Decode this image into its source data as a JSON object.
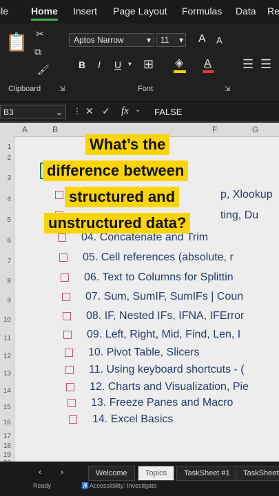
{
  "menu": {
    "tabs": [
      "ile",
      "Home",
      "Insert",
      "Page Layout",
      "Formulas",
      "Data",
      "Re"
    ],
    "active": "Home"
  },
  "ribbon": {
    "font_name": "Aptos Narrow",
    "font_size": "11",
    "grow_font": "A",
    "shrink_font": "A",
    "bold": "B",
    "italic": "I",
    "underline": "U",
    "clipboard_label": "Clipboard",
    "font_label": "Font",
    "colors": {
      "highlight": "#f5d000",
      "font_color": "#e53935"
    }
  },
  "formula_bar": {
    "name_box": "B3",
    "fx": "fx",
    "value": "FALSE"
  },
  "columns": [
    "A",
    "B",
    "",
    "",
    "",
    "F",
    "G"
  ],
  "rows": [
    "1",
    "2",
    "3",
    "4",
    "5",
    "6",
    "7",
    "8",
    "9",
    "10",
    "11",
    "12",
    "13",
    "14",
    "15",
    "16",
    "17",
    "18",
    "19",
    "20"
  ],
  "items": [
    "p, Xlookup",
    "ting, Du",
    "04. Concatenate and Trim",
    "05. Cell references (absolute, r",
    "06. Text to Columns for Splittin",
    "07. Sum, SumIF, SumIFs | Coun",
    "08. IF, Nested IFs, IFNA, IFError",
    "09. Left, Right, Mid, Find, Len, I",
    "10. Pivot Table, Slicers",
    "11. Using keyboard shortcuts - (",
    "12. Charts and Visualization, Pie",
    "13. Freeze Panes and Macro",
    "14. Excel Basics"
  ],
  "caption": {
    "lines": [
      "What’s the",
      "difference between",
      "structured and",
      "unstructured data?"
    ]
  },
  "sheets": {
    "tabs": [
      "Welcome",
      "Topics",
      "TaskSheet #1",
      "TaskSheet"
    ],
    "active": "Topics"
  },
  "status": {
    "ready": "Ready",
    "accessibility": "Accessibility: Investigate"
  }
}
